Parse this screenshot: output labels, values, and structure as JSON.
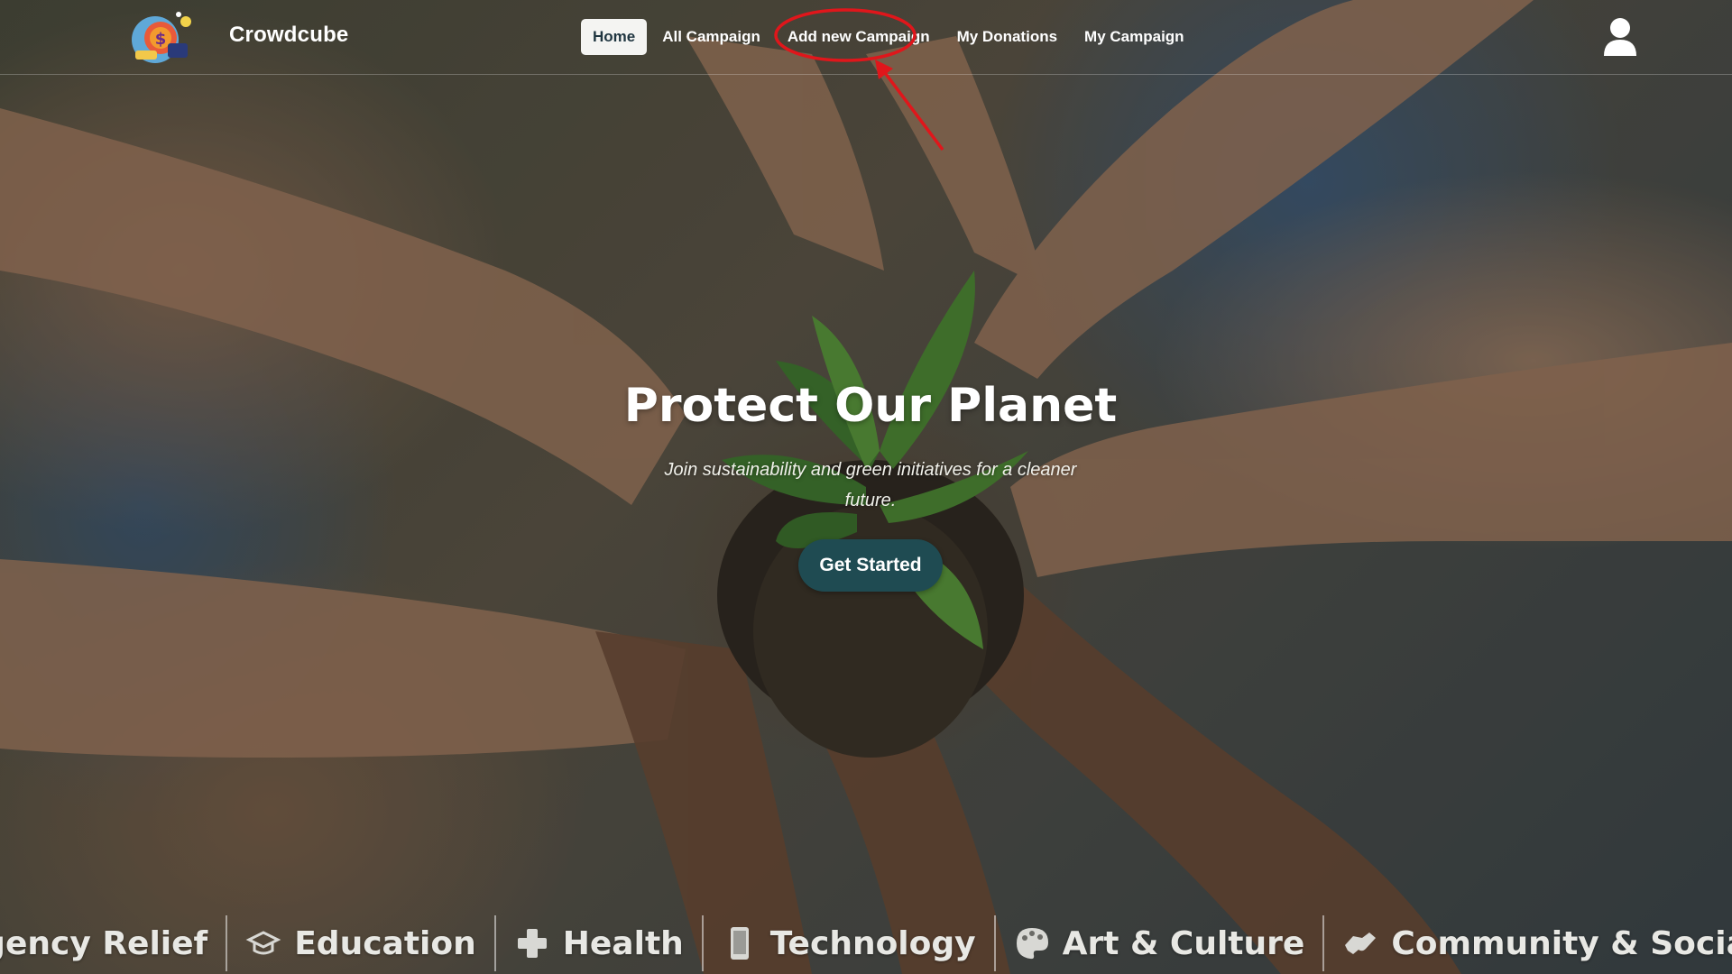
{
  "brand": {
    "name": "Crowdcube"
  },
  "nav": {
    "items": [
      {
        "label": "Home",
        "active": true
      },
      {
        "label": "All Campaign",
        "active": false
      },
      {
        "label": "Add new Campaign",
        "active": false,
        "annotated": true
      },
      {
        "label": "My Donations",
        "active": false
      },
      {
        "label": "My Campaign",
        "active": false
      }
    ],
    "user_icon": "user-icon"
  },
  "hero": {
    "title": "Protect Our Planet",
    "subtitle": "Join sustainability and green initiatives for a cleaner future.",
    "cta_label": "Get Started"
  },
  "categories": [
    {
      "label": "ergency Relief",
      "icon": ""
    },
    {
      "label": "Education",
      "icon": "graduation-cap-icon"
    },
    {
      "label": "Health",
      "icon": "medical-cross-icon"
    },
    {
      "label": "Technology",
      "icon": "mobile-device-icon"
    },
    {
      "label": "Art & Culture",
      "icon": "palette-icon"
    },
    {
      "label": "Community & Social",
      "icon": "handshake-icon"
    }
  ],
  "colors": {
    "accent": "#1f4b52",
    "annotation": "#e0161b",
    "nav_active_bg": "#f4f4f2"
  }
}
